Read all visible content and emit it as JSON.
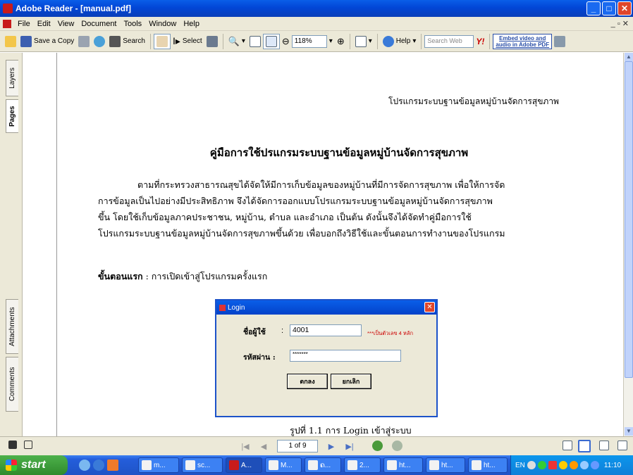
{
  "window": {
    "title": "Adobe Reader - [manual.pdf]"
  },
  "menu": [
    "File",
    "Edit",
    "View",
    "Document",
    "Tools",
    "Window",
    "Help"
  ],
  "toolbar": {
    "save_copy": "Save a Copy",
    "search": "Search",
    "select": "Select",
    "zoom": "118%",
    "help": "Help",
    "search_web_placeholder": "Search Web",
    "yahoo": "Y!",
    "embed_line1": "Embed video and",
    "embed_line2": "audio in Adobe PDF"
  },
  "nav_tabs": {
    "layers": "Layers",
    "pages": "Pages",
    "attachments": "Attachments",
    "comments": "Comments"
  },
  "document": {
    "header": "โปรแกรมระบบฐานข้อมูลหมู่บ้านจัดการสุขภาพ",
    "title": "คู่มือการใช้ปรแกรมระบบฐานข้อมูลหมู่บ้านจัดการสุขภาพ",
    "paragraph": [
      "ตามที่กระทรวงสาธารณสุขได้จัดให้มีการเก็บข้อมูลของหมู่บ้านที่มีการจัดการสุขภาพ   เพื่อให้การจัด",
      "การข้อมูลเป็นไปอย่างมีประสิทธิภาพ   จึงได้จัดการออกแบบโปรแกรมระบบฐานข้อมูลหมู่บ้านจัดการสุขภาพ",
      "ขึ้น  โดยใช้เก็บข้อมูลภาคประชาชน, หมู่บ้าน, ตำบล และอำเภอ เป็นต้น   ดังนั้นจึงได้จัดทำคู่มือการใช้",
      "โปรแกรมระบบฐานข้อมูลหมู่บ้านจัดการสุขภาพขึ้นด้วย เพื่อบอกถึงวิธีใช้และขั้นตอนการทำงานของโปรแกรม"
    ],
    "step_label": "ขั้นตอนแรก",
    "step_text": " : การเปิดเข้าสู่โปรแกรมครั้งแรก",
    "caption": "รูปที่  1.1 การ  Login  เข้าสู่ระบบ"
  },
  "login_dialog": {
    "title": "Login",
    "username_label": "ชื่อผู้ใช้",
    "username_value": "4001",
    "username_note": "***เป็นตัวเลข 4 หลัก",
    "password_label": "รหัสผ่าน :",
    "password_value": "*******",
    "ok": "ตกลง",
    "cancel": "ยกเลิก"
  },
  "statusbar": {
    "page": "1 of 9"
  },
  "taskbar": {
    "start": "start",
    "tasks": [
      "m...",
      "sc...",
      "A...",
      "M...",
      "ຄ...",
      "2...",
      "ht...",
      "ht...",
      "ht..."
    ],
    "lang": "EN",
    "clock": "11:10"
  }
}
